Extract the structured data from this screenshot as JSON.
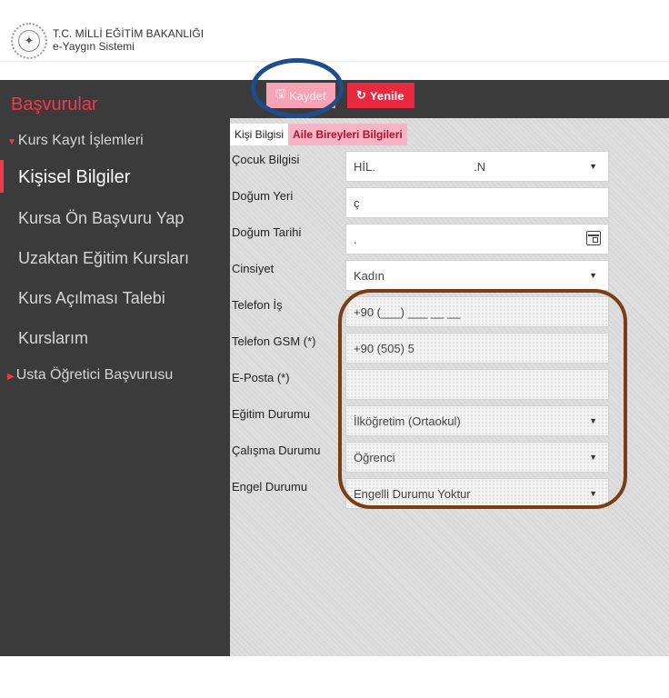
{
  "header": {
    "org_line1": "T.C. MİLLİ EĞİTİM BAKANLIĞI",
    "org_line2": "e-Yaygın Sistemi"
  },
  "sidebar": {
    "title": "Başvurular",
    "group_label": "Kurs Kayıt İşlemleri",
    "items": [
      {
        "label": "Kişisel Bilgiler",
        "active": true
      },
      {
        "label": "Kursa Ön Başvuru Yap"
      },
      {
        "label": "Uzaktan Eğitim Kursları"
      },
      {
        "label": "Kurs Açılması Talebi"
      },
      {
        "label": "Kurslarım"
      }
    ],
    "usta_label": "Usta Öğretici Başvurusu"
  },
  "toolbar": {
    "save_label": "Kaydet",
    "refresh_label": "Yenile"
  },
  "tabs": [
    {
      "label": "Kişi Bilgisi",
      "active": false
    },
    {
      "label": "Aile Bireyleri Bilgileri",
      "active": true
    }
  ],
  "form": {
    "cocuk_label": "Çocuk Bilgisi",
    "cocuk_value": "HİL.                              .N",
    "dogum_yeri_label": "Doğum Yeri",
    "dogum_yeri_value": "ç",
    "dogum_tarihi_label": "Doğum Tarihi",
    "dogum_tarihi_value": ".",
    "cinsiyet_label": "Cinsiyet",
    "cinsiyet_value": "Kadın",
    "tel_is_label": "Telefon İş",
    "tel_is_value": "+90 (___) ___ __ __",
    "tel_gsm_label": "Telefon GSM (*)",
    "tel_gsm_value": "+90 (505) 5",
    "eposta_label": "E-Posta (*)",
    "eposta_value": "",
    "egitim_label": "Eğitim Durumu",
    "egitim_value": "İlköğretim (Ortaokul)",
    "calisma_label": "Çalışma Durumu",
    "calisma_value": "Öğrenci",
    "engel_label": "Engel Durumu",
    "engel_value": "Engelli Durumu Yoktur"
  },
  "colors": {
    "accent": "#ef3a4d",
    "sidebar_bg": "#3b3b3b",
    "save_bg": "#f5a3b5",
    "refresh_bg": "#e8293f",
    "ellipse_annotation": "#1f4c8a",
    "rounded_annotation": "#7a3e14"
  }
}
